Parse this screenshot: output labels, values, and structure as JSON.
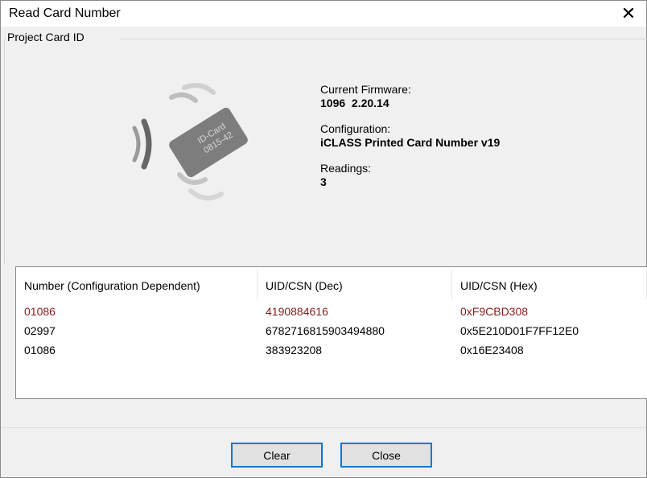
{
  "window": {
    "title": "Read Card Number",
    "close_glyph": "✕"
  },
  "group": {
    "label": "Project Card ID"
  },
  "illustration": {
    "card_text_line1": "ID-Card",
    "card_text_line2": "0815-42",
    "icon": "card-reader-icon"
  },
  "info": {
    "firmware_label": "Current Firmware:",
    "firmware_value": "1096  2.20.14",
    "config_label": "Configuration:",
    "config_value": "iCLASS Printed Card Number v19",
    "readings_label": "Readings:",
    "readings_value": "3"
  },
  "table": {
    "columns": [
      "Number (Configuration Dependent)",
      "UID/CSN (Dec)",
      "UID/CSN (Hex)"
    ],
    "rows": [
      {
        "number": "01086",
        "dec": "4190884616",
        "hex": "0xF9CBD308",
        "highlight": true
      },
      {
        "number": "02997",
        "dec": "6782716815903494880",
        "hex": "0x5E210D01F7FF12E0",
        "highlight": false
      },
      {
        "number": "01086",
        "dec": "383923208",
        "hex": "0x16E23408",
        "highlight": false
      }
    ],
    "highlight_color": "#8b1a1a"
  },
  "buttons": {
    "clear_label": "Clear",
    "close_label": "Close",
    "accent": "#0078d7"
  }
}
